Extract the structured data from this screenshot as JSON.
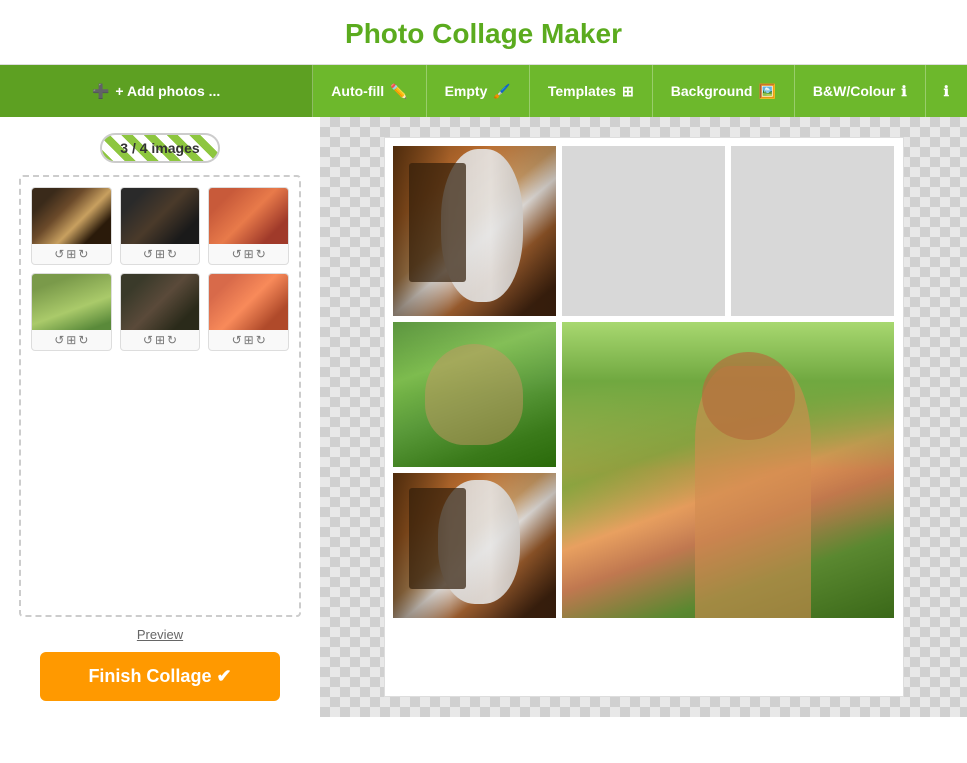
{
  "header": {
    "title": "Photo Collage Maker"
  },
  "toolbar": {
    "add_photos": "+ Add photos ...",
    "autofill": "Auto-fill",
    "empty": "Empty",
    "templates": "Templates",
    "background": "Background",
    "bw_colour": "B&W/Colour",
    "info": "ℹ"
  },
  "left_panel": {
    "image_count": "3 / 4 images",
    "preview_label": "Preview",
    "finish_label": "Finish Collage ✔"
  },
  "thumbnails": [
    {
      "id": 1,
      "row": 1,
      "col": 1
    },
    {
      "id": 2,
      "row": 1,
      "col": 2
    },
    {
      "id": 3,
      "row": 1,
      "col": 3
    },
    {
      "id": 4,
      "row": 2,
      "col": 1
    },
    {
      "id": 5,
      "row": 2,
      "col": 2
    },
    {
      "id": 6,
      "row": 2,
      "col": 3
    }
  ],
  "collage": {
    "cells": [
      {
        "id": "top-left",
        "filled": true,
        "photo": "halloween"
      },
      {
        "id": "top-middle",
        "filled": false
      },
      {
        "id": "top-right",
        "filled": false
      },
      {
        "id": "mid-left",
        "filled": true,
        "photo": "girl-sunglasses"
      },
      {
        "id": "mid-right",
        "filled": true,
        "photo": "field-large",
        "rowspan": 2
      },
      {
        "id": "bot-left",
        "filled": true,
        "photo": "halloween-2"
      }
    ]
  },
  "colors": {
    "green_primary": "#6db82c",
    "green_dark": "#5da022",
    "orange": "#f90000",
    "title_green": "#5bab1e"
  }
}
